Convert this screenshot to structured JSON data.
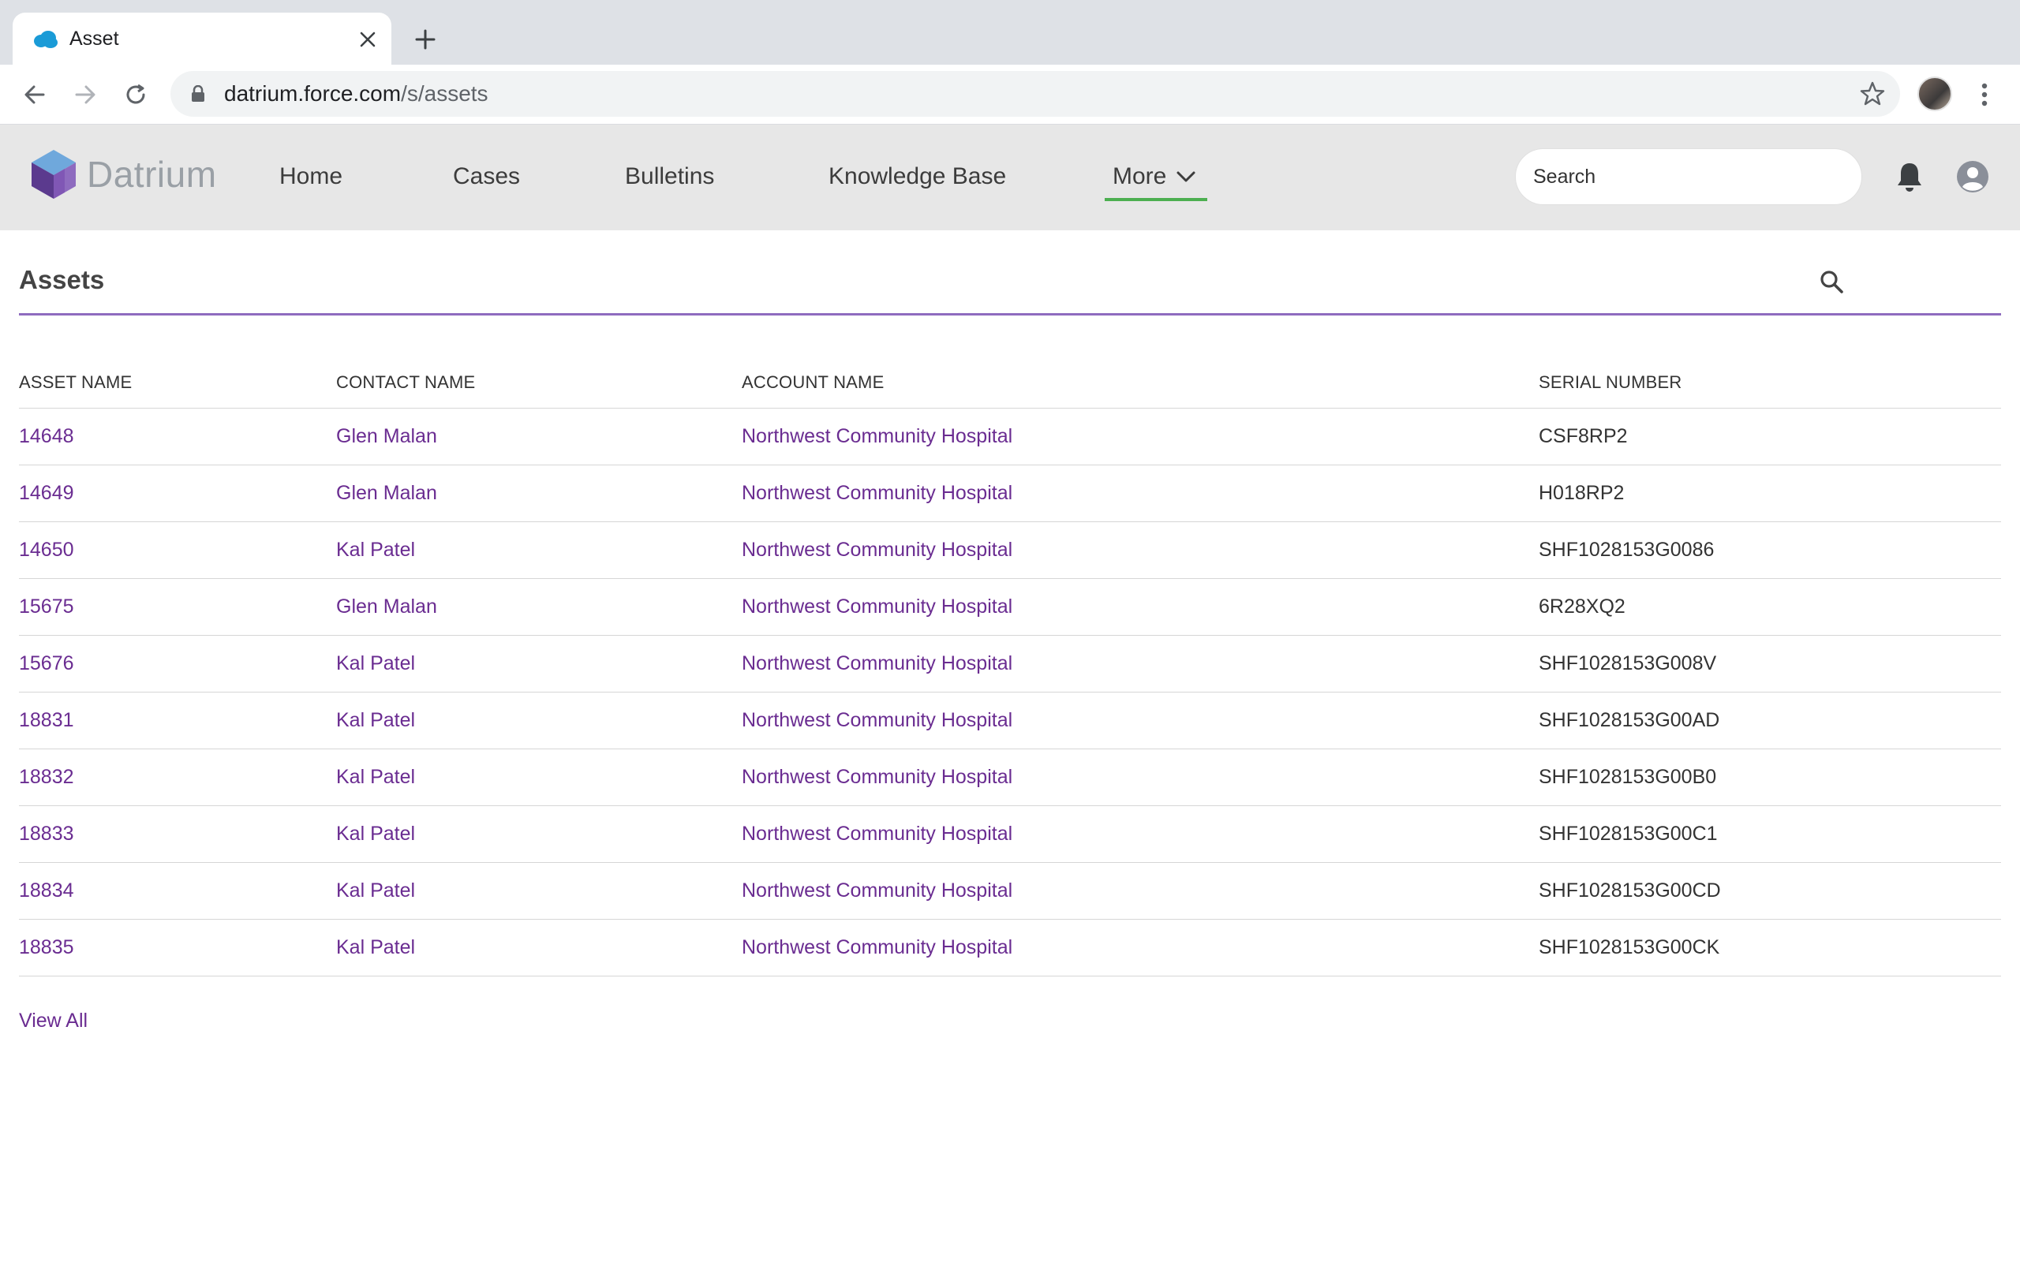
{
  "browser": {
    "tab_title": "Asset",
    "url_host": "datrium.force.com",
    "url_path": "/s/assets"
  },
  "header": {
    "logo_text": "Datrium",
    "nav": {
      "home": "Home",
      "cases": "Cases",
      "bulletins": "Bulletins",
      "knowledge_base": "Knowledge Base",
      "more": "More"
    },
    "search_placeholder": "Search"
  },
  "assets": {
    "title": "Assets",
    "columns": [
      "ASSET NAME",
      "CONTACT NAME",
      "ACCOUNT NAME",
      "SERIAL NUMBER"
    ],
    "rows": [
      {
        "asset": "14648",
        "contact": "Glen Malan",
        "account": "Northwest Community Hospital",
        "serial": "CSF8RP2"
      },
      {
        "asset": "14649",
        "contact": "Glen Malan",
        "account": "Northwest Community Hospital",
        "serial": "H018RP2"
      },
      {
        "asset": "14650",
        "contact": "Kal Patel",
        "account": "Northwest Community Hospital",
        "serial": "SHF1028153G0086"
      },
      {
        "asset": "15675",
        "contact": "Glen Malan",
        "account": "Northwest Community Hospital",
        "serial": "6R28XQ2"
      },
      {
        "asset": "15676",
        "contact": "Kal Patel",
        "account": "Northwest Community Hospital",
        "serial": "SHF1028153G008V"
      },
      {
        "asset": "18831",
        "contact": "Kal Patel",
        "account": "Northwest Community Hospital",
        "serial": "SHF1028153G00AD"
      },
      {
        "asset": "18832",
        "contact": "Kal Patel",
        "account": "Northwest Community Hospital",
        "serial": "SHF1028153G00B0"
      },
      {
        "asset": "18833",
        "contact": "Kal Patel",
        "account": "Northwest Community Hospital",
        "serial": "SHF1028153G00C1"
      },
      {
        "asset": "18834",
        "contact": "Kal Patel",
        "account": "Northwest Community Hospital",
        "serial": "SHF1028153G00CD"
      },
      {
        "asset": "18835",
        "contact": "Kal Patel",
        "account": "Northwest Community Hospital",
        "serial": "SHF1028153G00CK"
      }
    ],
    "view_all": "View All"
  },
  "colors": {
    "link": "#6a2c91",
    "accent_rule": "#8e6bbf",
    "nav_active_underline": "#4caf50",
    "header_bg": "#e7e7e7"
  },
  "icons": [
    "salesforce-cloud-icon",
    "close-icon",
    "plus-icon",
    "back-arrow-icon",
    "forward-arrow-icon",
    "reload-icon",
    "lock-icon",
    "star-icon",
    "kebab-menu-icon",
    "datrium-cube-logo",
    "chevron-down-icon",
    "bell-icon",
    "user-icon",
    "search-icon"
  ]
}
